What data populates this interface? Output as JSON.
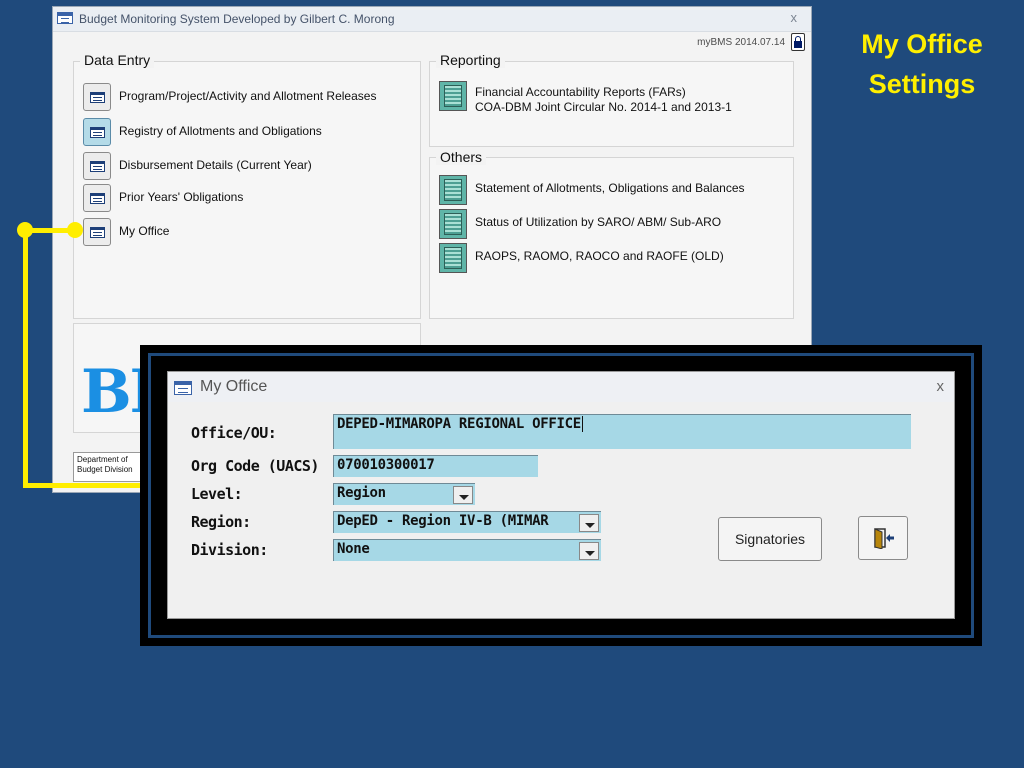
{
  "slide": {
    "title_line1": "My Office",
    "title_line2": "Settings"
  },
  "main_window": {
    "title": "Budget Monitoring System Developed by Gilbert C. Morong",
    "close_glyph": "x",
    "version": "myBMS 2014.07.14",
    "data_entry": {
      "label": "Data Entry",
      "items": [
        {
          "label": "Program/Project/Activity and Allotment Releases"
        },
        {
          "label": "Registry of Allotments and Obligations"
        },
        {
          "label": "Disbursement Details (Current Year)"
        },
        {
          "label": "Prior Years' Obligations"
        },
        {
          "label": "My Office"
        }
      ]
    },
    "reporting": {
      "label": "Reporting",
      "items": [
        {
          "line1": "Financial Accountability Reports (FARs)",
          "line2": "COA-DBM Joint Circular No. 2014-1 and 2013-1"
        }
      ]
    },
    "others": {
      "label": "Others",
      "items": [
        {
          "label": "Statement of Allotments, Obligations and Balances"
        },
        {
          "label": "Status of Utilization by SARO/ ABM/ Sub-ARO"
        },
        {
          "label": "RAOPS, RAOMO, RAOCO and RAOFE (OLD)"
        }
      ]
    },
    "logo_text": "BM",
    "footer_line1": "Department of",
    "footer_line2": "Budget Division"
  },
  "popup": {
    "title": "My Office",
    "close_glyph": "x",
    "fields": {
      "office_label": "Office/OU:",
      "office_value": "DEPED-MIMAROPA REGIONAL OFFICE",
      "org_label": "Org Code (UACS)",
      "org_value": "070010300017",
      "level_label": "Level:",
      "level_value": "Region",
      "region_label": "Region:",
      "region_value": "DepED - Region IV-B (MIMAR",
      "division_label": "Division:",
      "division_value": "None"
    },
    "signatories_label": "Signatories"
  },
  "colors": {
    "background": "#1f4a7c",
    "title_yellow": "#ffef00",
    "connector": "#ffee00",
    "field_fill": "#a6d8e6"
  }
}
